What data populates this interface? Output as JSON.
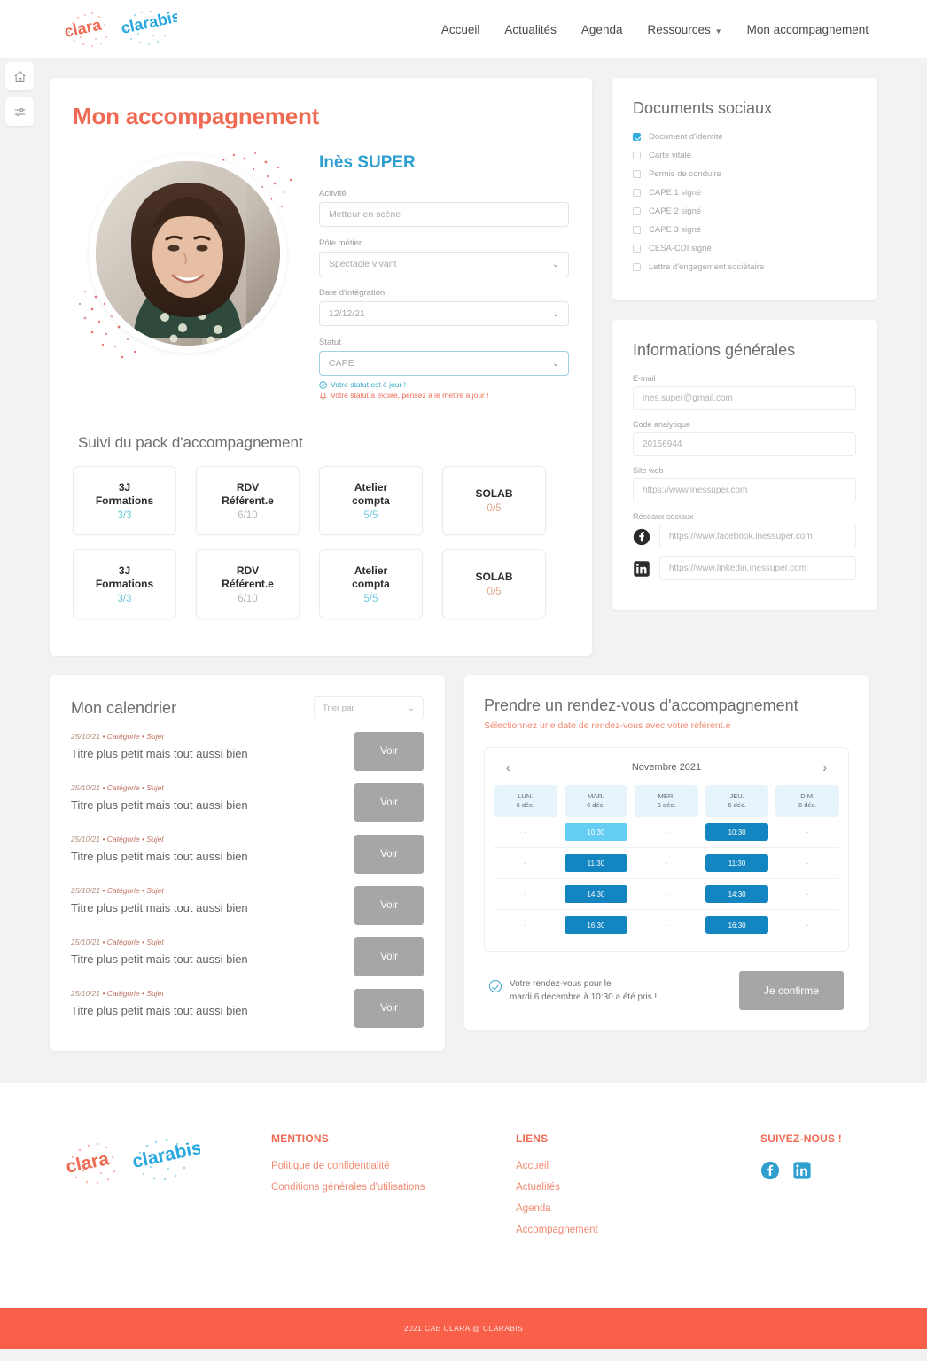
{
  "header": {
    "logo_primary": "clara",
    "logo_secondary": "clarabis",
    "nav": [
      {
        "label": "Accueil",
        "has_caret": false
      },
      {
        "label": "Actualités",
        "has_caret": false
      },
      {
        "label": "Agenda",
        "has_caret": false
      },
      {
        "label": "Ressources",
        "has_caret": true
      },
      {
        "label": "Mon accompagnement",
        "has_caret": false
      }
    ]
  },
  "rail": {
    "home_icon": "home-icon",
    "settings_icon": "sliders-icon"
  },
  "main": {
    "page_title": "Mon accompagnement",
    "person_name": "Inès SUPER",
    "fields": [
      {
        "label": "Activité",
        "value": "Metteur en scène",
        "type": "text"
      },
      {
        "label": "Pôle métier",
        "value": "Spectacle vivant",
        "type": "select"
      },
      {
        "label": "Date d'intégration",
        "value": "12/12/21",
        "type": "select"
      },
      {
        "label": "Statut",
        "value": "CAPE",
        "type": "select",
        "focused": true
      }
    ],
    "status_ok": "Votre statut est à jour !",
    "status_warn": "Votre statut a expiré, pensez à le mettre à jour !",
    "suivi_title": "Suivi du pack d'accompagnement",
    "tiles": [
      {
        "line1": "3J",
        "line2": "Formations",
        "value": "3/3",
        "color": "#6ec9dd"
      },
      {
        "line1": "RDV",
        "line2": "Référent.e",
        "value": "6/10",
        "color": "#b5b5b5"
      },
      {
        "line1": "Atelier",
        "line2": "compta",
        "value": "5/5",
        "color": "#6ec9dd"
      },
      {
        "line1": "SOLAB",
        "line2": "",
        "value": "0/5",
        "color": "#e3a88f"
      },
      {
        "line1": "3J",
        "line2": "Formations",
        "value": "3/3",
        "color": "#6ec9dd"
      },
      {
        "line1": "RDV",
        "line2": "Référent.e",
        "value": "6/10",
        "color": "#b5b5b5"
      },
      {
        "line1": "Atelier",
        "line2": "compta",
        "value": "5/5",
        "color": "#6ec9dd"
      },
      {
        "line1": "SOLAB",
        "line2": "",
        "value": "0/5",
        "color": "#e3a88f"
      }
    ]
  },
  "documents": {
    "title": "Documents sociaux",
    "items": [
      {
        "label": "Document d'identité",
        "checked": true
      },
      {
        "label": "Carte vitale",
        "checked": false
      },
      {
        "label": "Permis de conduire",
        "checked": false
      },
      {
        "label": "CAPE 1 signé",
        "checked": false
      },
      {
        "label": "CAPE 2 signé",
        "checked": false
      },
      {
        "label": "CAPE 3 signé",
        "checked": false
      },
      {
        "label": "CESA-CDI signé",
        "checked": false
      },
      {
        "label": "Lettre d'engagement sociétaire",
        "checked": false
      }
    ]
  },
  "infos": {
    "title": "Informations générales",
    "email_label": "E-mail",
    "email_value": "ines.super@gmail.com",
    "code_label": "Code analytique",
    "code_value": "20156944",
    "site_label": "Site web",
    "site_value": "https://www.inessuper.com",
    "social_label": "Réseaux sociaux",
    "facebook_value": "https://www.facebook.inessuper.com",
    "linkedin_value": "https://www.linkedin.inessuper.com"
  },
  "calendrier": {
    "title": "Mon calendrier",
    "sort_placeholder": "Trier par",
    "events": [
      {
        "date": "25/10/21",
        "category": "Catégorie",
        "subject": "Sujet",
        "title": "Titre plus petit mais tout aussi bien",
        "button": "Voir"
      },
      {
        "date": "25/10/21",
        "category": "Catégorie",
        "subject": "Sujet",
        "title": "Titre plus petit mais tout aussi bien",
        "button": "Voir"
      },
      {
        "date": "25/10/21",
        "category": "Catégorie",
        "subject": "Sujet",
        "title": "Titre plus petit mais tout aussi bien",
        "button": "Voir"
      },
      {
        "date": "25/10/21",
        "category": "Catégorie",
        "subject": "Sujet",
        "title": "Titre plus petit mais tout aussi bien",
        "button": "Voir"
      },
      {
        "date": "25/10/21",
        "category": "Catégorie",
        "subject": "Sujet",
        "title": "Titre plus petit mais tout aussi bien",
        "button": "Voir"
      },
      {
        "date": "25/10/21",
        "category": "Catégorie",
        "subject": "Sujet",
        "title": "Titre plus petit mais tout aussi bien",
        "button": "Voir"
      }
    ]
  },
  "rdv": {
    "title": "Prendre un rendez-vous d'accompagnement",
    "subtitle": "Sélectionnez une date de rendez-vous avec votre référent.e",
    "prev_icon": "chevron-left-icon",
    "next_icon": "chevron-right-icon",
    "month": "Novembre 2021",
    "days": [
      {
        "name": "LUN.",
        "date": "6 déc."
      },
      {
        "name": "MAR.",
        "date": "6 déc."
      },
      {
        "name": "MER.",
        "date": "6 déc."
      },
      {
        "name": "JEU.",
        "date": "6 déc."
      },
      {
        "name": "DIM.",
        "date": "6 déc."
      }
    ],
    "slot_rows": [
      [
        "-",
        "10:30",
        "-",
        "10:30",
        "-"
      ],
      [
        "-",
        "11:30",
        "-",
        "11:30",
        "-"
      ],
      [
        "-",
        "14:30",
        "-",
        "14:30",
        "-"
      ],
      [
        "-",
        "16:30",
        "-",
        "16:30",
        "-"
      ]
    ],
    "selected_row": 0,
    "selected_col": 1,
    "confirm_line1": "Votre rendez-vous pour le",
    "confirm_line2": "mardi 6 décembre à 10:30 a été pris !",
    "confirm_button": "Je confirme"
  },
  "footer": {
    "mentions_title": "MENTIONS",
    "mentions": [
      "Politique de confidentialité",
      "Conditions générales d'utilisations"
    ],
    "liens_title": "LIENS",
    "liens": [
      "Accueil",
      "Actualités",
      "Agenda",
      "Accompagnement"
    ],
    "social_title": "SUIVEZ-NOUS !",
    "social": [
      "facebook-icon",
      "linkedin-icon"
    ],
    "copyright": "2021 CAE CLARA @ CLARABIS"
  },
  "colors": {
    "brand_red": "#ef6a53",
    "brand_blue": "#2f9fd0",
    "slot_blue": "#1385c0",
    "slot_selected": "#63cdf3",
    "copy_bar": "#f8604a"
  }
}
